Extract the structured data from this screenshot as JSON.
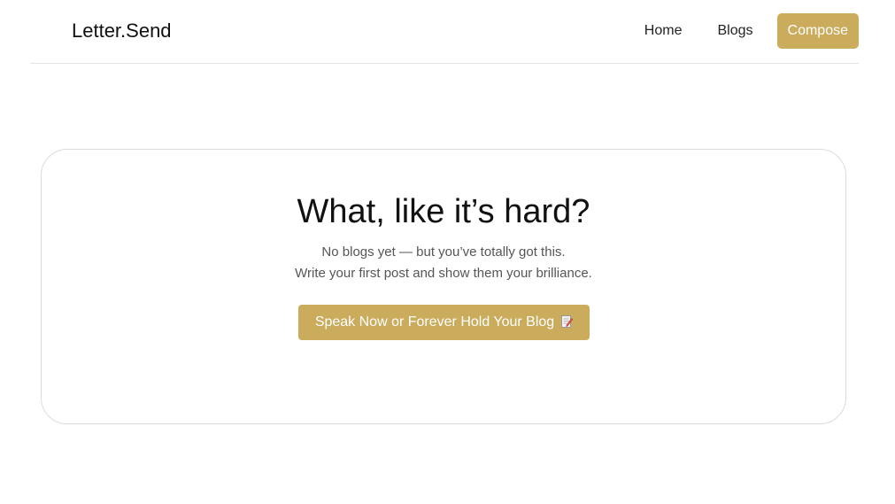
{
  "colors": {
    "accent": "#cbab5c"
  },
  "header": {
    "brand": "Letter.Send",
    "nav": {
      "home": "Home",
      "blogs": "Blogs",
      "compose": "Compose"
    }
  },
  "empty_state": {
    "title": "What, like it’s hard?",
    "subtitle_line1": "No blogs yet — but you’ve totally got this.",
    "subtitle_line2": "Write your first post and show them your brilliance.",
    "cta_label": "Speak Now or Forever Hold Your Blog",
    "cta_icon": "memo-icon"
  }
}
